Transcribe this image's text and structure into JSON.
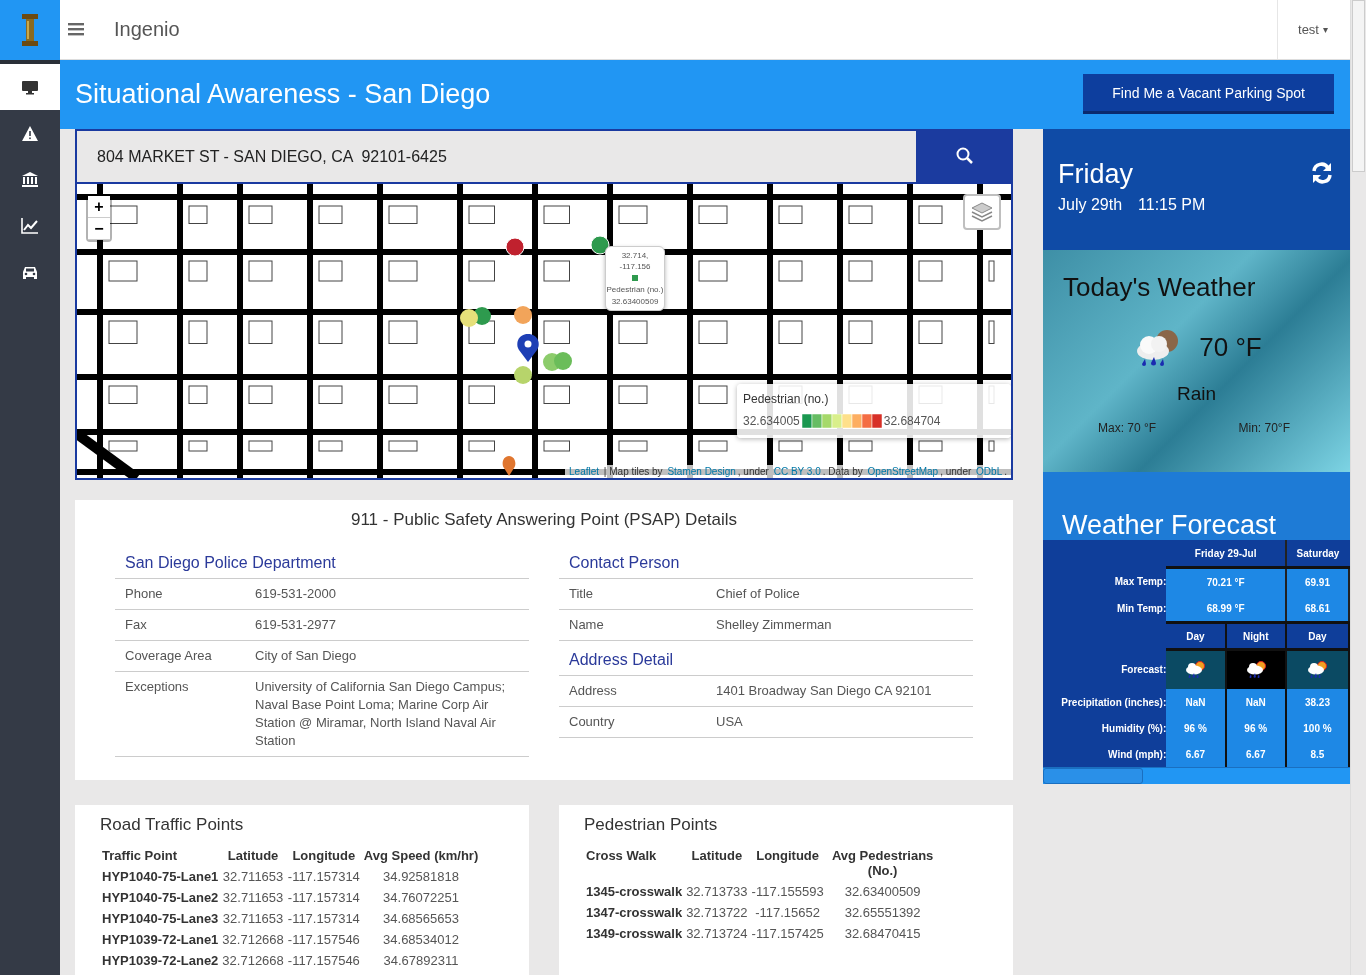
{
  "app": {
    "brand": "Ingenio",
    "user": "test",
    "user_caret": "▾"
  },
  "sidebar": {
    "items": [
      {
        "kind": "monitor",
        "selected": true
      },
      {
        "kind": "warning",
        "selected": false
      },
      {
        "kind": "bank",
        "selected": false
      },
      {
        "kind": "chart",
        "selected": false
      },
      {
        "kind": "car",
        "selected": false
      }
    ]
  },
  "header": {
    "title": "Situational Awareness - San Diego",
    "button": "Find Me a Vacant Parking Spot"
  },
  "search": {
    "value": "804 MARKET ST - SAN DIEGO, CA  92101-6425"
  },
  "map": {
    "zoom_in": "+",
    "zoom_out": "−",
    "popup": {
      "coords": "32.714, -117.156",
      "label": "Pedestrian (no.)",
      "value": "32.63400509"
    },
    "legend": {
      "title": "Pedestrian (no.)",
      "min": "32.634005",
      "max": "32.684704"
    },
    "attribution": [
      {
        "text": "Leaflet",
        "link": true
      },
      {
        "text": " | Map tiles by ",
        "link": false
      },
      {
        "text": "Stamen Design",
        "link": true
      },
      {
        "text": ", under ",
        "link": false
      },
      {
        "text": "CC BY 3.0",
        "link": true
      },
      {
        "text": ". Data by ",
        "link": false
      },
      {
        "text": "OpenStreetMap",
        "link": true
      },
      {
        "text": ", under ",
        "link": false
      },
      {
        "text": "ODbL",
        "link": true
      },
      {
        "text": ".",
        "link": false
      }
    ]
  },
  "psap": {
    "title": "911 - Public Safety Answering Point (PSAP) Details",
    "left": [
      {
        "heading": "San Diego Police Department",
        "rows": [
          {
            "label": "Phone",
            "value": "619-531-2000"
          },
          {
            "label": "Fax",
            "value": "619-531-2977"
          },
          {
            "label": "Coverage Area",
            "value": "City of San Diego"
          },
          {
            "label": "Exceptions",
            "value": "University of California San Diego Campus; Naval Base Point Loma; Marine Corp Air Station @ Miramar, North Island Naval Air Station"
          }
        ]
      }
    ],
    "right": [
      {
        "heading": "Contact Person",
        "rows": [
          {
            "label": "Title",
            "value": "Chief of Police"
          },
          {
            "label": "Name",
            "value": "Shelley Zimmerman"
          }
        ]
      },
      {
        "heading": "Address Detail",
        "rows": [
          {
            "label": "Address",
            "value": "1401 Broadway San Diego CA 92101"
          },
          {
            "label": "Country",
            "value": "USA"
          }
        ]
      }
    ]
  },
  "traffic": {
    "title": "Road Traffic Points",
    "columns": [
      "Traffic Point",
      "Latitude",
      "Longitude",
      "Avg Speed (km/hr)"
    ],
    "rows": [
      [
        "HYP1040-75-Lane1",
        "32.711653",
        "-117.157314",
        "34.92581818"
      ],
      [
        "HYP1040-75-Lane2",
        "32.711653",
        "-117.157314",
        "34.76072251"
      ],
      [
        "HYP1040-75-Lane3",
        "32.711653",
        "-117.157314",
        "34.68565653"
      ],
      [
        "HYP1039-72-Lane1",
        "32.712668",
        "-117.157546",
        "34.68534012"
      ],
      [
        "HYP1039-72-Lane2",
        "32.712668",
        "-117.157546",
        "34.67892311"
      ]
    ]
  },
  "pedestrian": {
    "title": "Pedestrian Points",
    "columns": [
      "Cross Walk",
      "Latitude",
      "Longitude",
      "Avg Pedestrians (No.)"
    ],
    "rows": [
      [
        "1345-crosswalk",
        "32.713733",
        "-117.155593",
        "32.63400509"
      ],
      [
        "1347-crosswalk",
        "32.713722",
        "-117.15652",
        "32.65551392"
      ],
      [
        "1349-crosswalk",
        "32.713724",
        "-117.157425",
        "32.68470415"
      ]
    ]
  },
  "clock": {
    "day": "Friday",
    "date": "July 29th",
    "time": "11:15 PM"
  },
  "today": {
    "title": "Today's Weather",
    "temp": "70 °F",
    "condition": "Rain",
    "max": "Max: 70 °F",
    "min": "Min: 70°F"
  },
  "forecast": {
    "title": "Weather Forecast",
    "row_labels": {
      "max": "Max Temp:",
      "min": "Min Temp:",
      "forecast": "Forecast:",
      "precipitation": "Precipitation (inches):",
      "humidity": "Humidity (%):",
      "wind": "Wind (mph):"
    },
    "days": [
      {
        "label": "Friday 29-Jul",
        "max": "70.21 °F",
        "min": "68.99 °F",
        "periods": [
          {
            "kind": "day",
            "label": "Day",
            "precipitation": "NaN",
            "humidity": "96 %",
            "wind": "6.67"
          },
          {
            "kind": "night",
            "label": "Night",
            "precipitation": "NaN",
            "humidity": "96 %",
            "wind": "6.67"
          }
        ]
      },
      {
        "label": "Saturday",
        "max": "69.91",
        "min": "68.61",
        "periods": [
          {
            "kind": "day",
            "label": "Day",
            "precipitation": "38.23",
            "humidity": "100 %",
            "wind": "8.5"
          }
        ]
      }
    ]
  }
}
